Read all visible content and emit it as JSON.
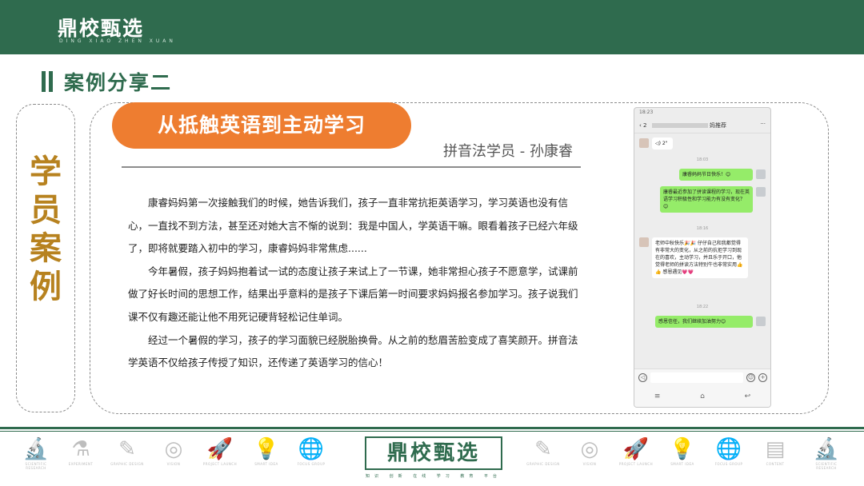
{
  "header": {
    "logo": "鼎校甄选",
    "logo_sub": "DING XIAO ZHEN XUAN"
  },
  "section": {
    "title": "案例分享二"
  },
  "sidebar": {
    "text": "学员案例"
  },
  "case": {
    "headline": "从抵触英语到主动学习",
    "author": "拼音法学员 - 孙康睿",
    "paragraphs": [
      "康睿妈妈第一次接触我们的时候，她告诉我们，孩子一直非常抗拒英语学习，学习英语也没有信心，一直找不到方法，甚至还对她大言不惭的说到：我是中国人，学英语干嘛。眼看着孩子已经六年级了，即将就要踏入初中的学习，康睿妈妈非常焦虑......",
      "今年暑假，孩子妈妈抱着试一试的态度让孩子来试上了一节课，她非常担心孩子不愿意学，试课前做了好长时间的思想工作，结果出乎意料的是孩子下课后第一时间要求妈妈报名参加学习。孩子说我们课不仅有趣还能让他不用死记硬背轻松记住单词。",
      "经过一个暑假的学习，孩子的学习面貌已经脱胎换骨。从之前的愁眉苦脸变成了喜笑颜开。拼音法学英语不仅给孩子传授了知识，还传递了英语学习的信心！"
    ]
  },
  "phone": {
    "status_time": "18:23",
    "header_back": "‹ 2",
    "header_suffix": "妈推荐",
    "more": "···",
    "voice": "◁) 2\"",
    "time1": "18:03",
    "msg1": "康睿妈妈节日快乐！😊",
    "msg2": "康睿最近参加了拼读课程的学习，现在英语学习积极性和学习能力有没有变化？😊",
    "time2": "18:16",
    "msg3": "老师中秋快乐🎉🎉 仔仔自己和我都觉得有非常大的变化，从之前的抗拒学习到现在的喜欢，主动学习，并且乐于开口，他觉得老师的拼读方法特别牛也非常实用👍👍 感恩遇见💗💗",
    "time3": "18:22",
    "msg4": "感恩信任，我们继续加油努力😊"
  },
  "footer": {
    "logo": "鼎校甄选",
    "logo_sub": "知识 创新 在线 学习 教育 平台",
    "icons_left": [
      {
        "name": "microscope-icon",
        "glyph": "🔬",
        "label": "SCIENTIFIC RESEARCH"
      },
      {
        "name": "flask-icon",
        "glyph": "⚗",
        "label": "EXPERIMENT"
      },
      {
        "name": "design-board-icon",
        "glyph": "✎",
        "label": "GRAPHIC DESIGN"
      },
      {
        "name": "target-icon",
        "glyph": "◎",
        "label": "VISION"
      },
      {
        "name": "rocket-icon",
        "glyph": "🚀",
        "label": "PROJECT LAUNCH"
      },
      {
        "name": "lightbulb-icon",
        "glyph": "💡",
        "label": "SMART IDEA"
      },
      {
        "name": "globe-icon",
        "glyph": "🌐",
        "label": "FOCUS GROUP"
      }
    ],
    "icons_right": [
      {
        "name": "design-board-icon",
        "glyph": "✎",
        "label": "GRAPHIC DESIGN"
      },
      {
        "name": "target-icon",
        "glyph": "◎",
        "label": "VISION"
      },
      {
        "name": "rocket-icon",
        "glyph": "🚀",
        "label": "PROJECT LAUNCH"
      },
      {
        "name": "lightbulb-icon",
        "glyph": "💡",
        "label": "SMART IDEA"
      },
      {
        "name": "globe-icon",
        "glyph": "🌐",
        "label": "FOCUS GROUP"
      },
      {
        "name": "document-icon",
        "glyph": "▤",
        "label": "CONTENT"
      },
      {
        "name": "microscope-icon",
        "glyph": "🔬",
        "label": "SCIENTIFIC RESEARCH"
      }
    ]
  },
  "colors": {
    "brand_green": "#2f6b4e",
    "accent_orange": "#ee7d30",
    "sidebar_gold": "#b7821f"
  }
}
